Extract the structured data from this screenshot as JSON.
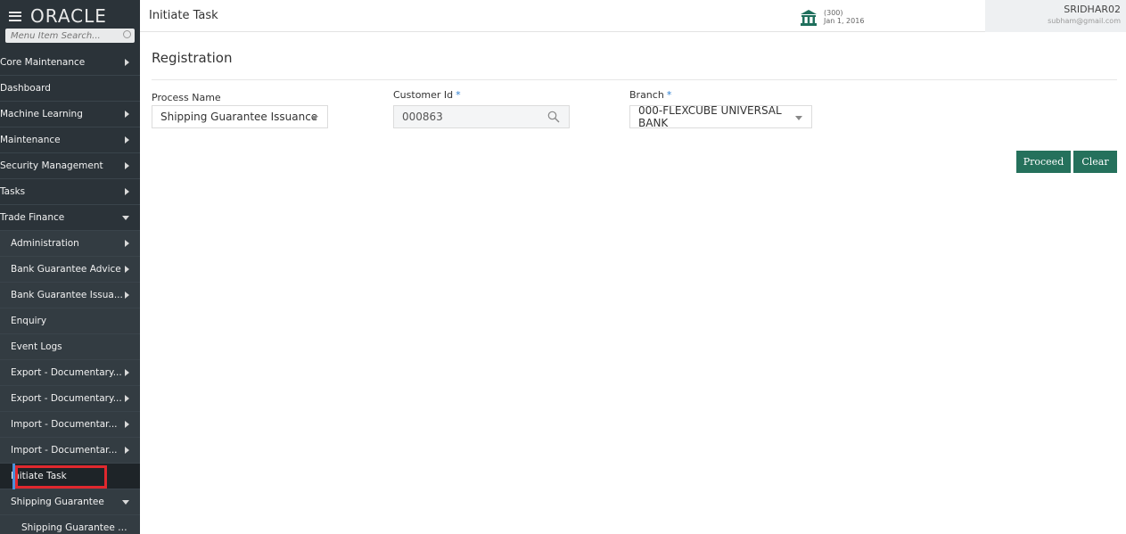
{
  "brand": {
    "logo": "ORACLE"
  },
  "search": {
    "placeholder": "Menu Item Search..."
  },
  "sidebar": {
    "items": [
      {
        "label": "Core Maintenance",
        "arrow": "right",
        "level": "top"
      },
      {
        "label": "Dashboard",
        "arrow": "",
        "level": "top"
      },
      {
        "label": "Machine Learning",
        "arrow": "right",
        "level": "top"
      },
      {
        "label": "Maintenance",
        "arrow": "right",
        "level": "top"
      },
      {
        "label": "Security Management",
        "arrow": "right",
        "level": "top"
      },
      {
        "label": "Tasks",
        "arrow": "right",
        "level": "top"
      },
      {
        "label": "Trade Finance",
        "arrow": "down",
        "level": "top"
      },
      {
        "label": "Administration",
        "arrow": "right",
        "level": "sub"
      },
      {
        "label": "Bank Guarantee Advice",
        "arrow": "right",
        "level": "sub"
      },
      {
        "label": "Bank Guarantee Issua...",
        "arrow": "right",
        "level": "sub"
      },
      {
        "label": "Enquiry",
        "arrow": "",
        "level": "sub"
      },
      {
        "label": "Event Logs",
        "arrow": "",
        "level": "sub"
      },
      {
        "label": "Export - Documentary...",
        "arrow": "right",
        "level": "sub"
      },
      {
        "label": "Export - Documentary...",
        "arrow": "right",
        "level": "sub"
      },
      {
        "label": "Import - Documentar...",
        "arrow": "right",
        "level": "sub"
      },
      {
        "label": "Import - Documentar...",
        "arrow": "right",
        "level": "sub"
      },
      {
        "label": "Initiate Task",
        "arrow": "",
        "level": "sub",
        "active": true
      },
      {
        "label": "Shipping Guarantee",
        "arrow": "down",
        "level": "sub"
      },
      {
        "label": "Shipping Guarantee Is...",
        "arrow": "",
        "level": "subsub"
      }
    ]
  },
  "header": {
    "title": "Initiate Task",
    "branch_code": "(300)",
    "branch_date": "Jan 1, 2016",
    "user_name": "SRIDHAR02",
    "user_email": "subham@gmail.com"
  },
  "form": {
    "section_title": "Registration",
    "process_name": {
      "label": "Process Name",
      "value": "Shipping Guarantee Issuance"
    },
    "customer_id": {
      "label": "Customer Id",
      "required": "*",
      "value": "000863"
    },
    "branch": {
      "label": "Branch",
      "required": "*",
      "value": "000-FLEXCUBE UNIVERSAL BANK"
    }
  },
  "actions": {
    "proceed_label": "Proceed",
    "clear_label": "Clear"
  },
  "colors": {
    "sidebar_bg": "#2b3339",
    "button_green": "#25715c",
    "highlight_red": "#e0282e",
    "required_blue": "#2e7fd1"
  },
  "icons": [
    "hamburger-icon",
    "search-icon",
    "bank-icon",
    "lookup-search-icon",
    "dropdown-arrow-icon"
  ]
}
